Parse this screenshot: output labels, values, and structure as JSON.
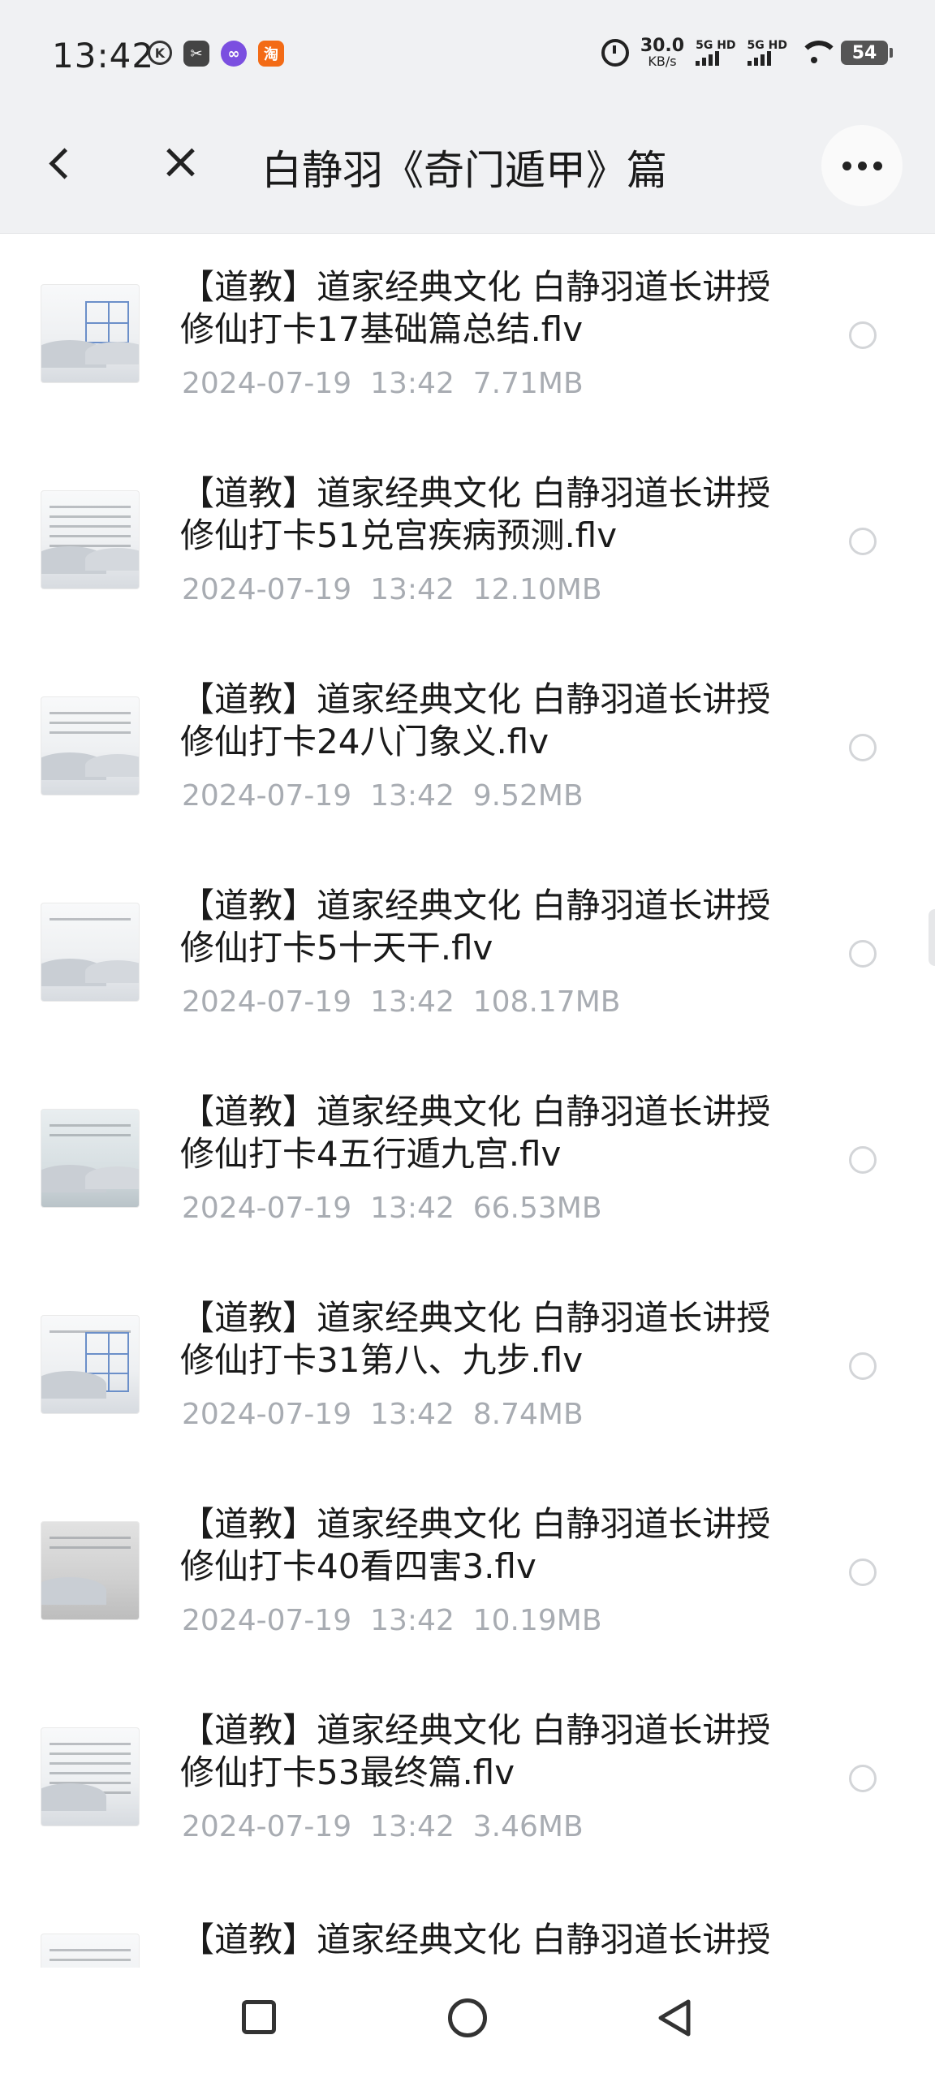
{
  "status_bar": {
    "time": "13:42",
    "left_icons": [
      "k-icon",
      "app-icon",
      "infinity-app-icon",
      "taobao-icon"
    ],
    "taobao_label": "淘",
    "k_label": "K",
    "speed_value": "30.0",
    "speed_unit": "KB/s",
    "net1": "5G HD",
    "net2": "5G HD",
    "battery": "54"
  },
  "header": {
    "title": "白静羽《奇门遁甲》篇",
    "back_icon": "chevron-left-icon",
    "close_icon": "close-icon",
    "more_icon": "more-horizontal-icon"
  },
  "files": [
    {
      "title": "【道教】道家经典文化 白静羽道长讲授修仙打卡17基础篇总结.flv",
      "date": "2024-07-19",
      "time": "13:42",
      "size": "7.71MB"
    },
    {
      "title": "【道教】道家经典文化 白静羽道长讲授修仙打卡51兑宫疾病预测.flv",
      "date": "2024-07-19",
      "time": "13:42",
      "size": "12.10MB"
    },
    {
      "title": "【道教】道家经典文化 白静羽道长讲授修仙打卡24八门象义.flv",
      "date": "2024-07-19",
      "time": "13:42",
      "size": "9.52MB"
    },
    {
      "title": "【道教】道家经典文化 白静羽道长讲授修仙打卡5十天干.flv",
      "date": "2024-07-19",
      "time": "13:42",
      "size": "108.17MB"
    },
    {
      "title": "【道教】道家经典文化 白静羽道长讲授修仙打卡4五行遁九宫.flv",
      "date": "2024-07-19",
      "time": "13:42",
      "size": "66.53MB"
    },
    {
      "title": "【道教】道家经典文化 白静羽道长讲授修仙打卡31第八、九步.flv",
      "date": "2024-07-19",
      "time": "13:42",
      "size": "8.74MB"
    },
    {
      "title": "【道教】道家经典文化 白静羽道长讲授修仙打卡40看四害3.flv",
      "date": "2024-07-19",
      "time": "13:42",
      "size": "10.19MB"
    },
    {
      "title": "【道教】道家经典文化 白静羽道长讲授修仙打卡53最终篇.flv",
      "date": "2024-07-19",
      "time": "13:42",
      "size": "3.46MB"
    },
    {
      "title": "【道教】道家经典文化 白静羽道长讲授",
      "date": "",
      "time": "",
      "size": ""
    }
  ],
  "nav": {
    "recent_icon": "square-icon",
    "home_icon": "circle-icon",
    "back_icon": "triangle-back-icon"
  }
}
